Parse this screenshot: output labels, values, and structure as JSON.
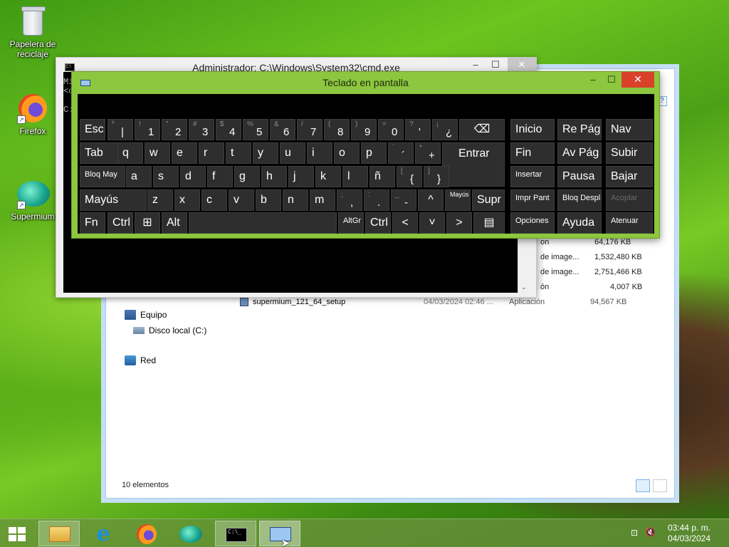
{
  "desktop": {
    "icons": [
      {
        "label": "Papelera de reciclaje"
      },
      {
        "label": "Firefox"
      },
      {
        "label": "Supermium"
      }
    ]
  },
  "explorer": {
    "nav": [
      "Equipo",
      "Disco local (C:)",
      "Red"
    ],
    "files": [
      {
        "name": "",
        "date": "",
        "type": "on",
        "size": "64,176 KB"
      },
      {
        "name": "",
        "date": "",
        "type": "de image...",
        "size": "1,532,480 KB"
      },
      {
        "name": "",
        "date": "",
        "type": "de image...",
        "size": "2,751,466 KB"
      },
      {
        "name": "",
        "date": "",
        "type": "ón",
        "size": "4,007 KB"
      },
      {
        "name": "supermium_121_64_setup",
        "date": "04/03/2024 02:46 ...",
        "type": "Aplicación",
        "size": "94,567 KB"
      }
    ],
    "status": "10 elementos"
  },
  "cmd": {
    "title": "Administrador: C:\\Windows\\System32\\cmd.exe",
    "lines": [
      "Mi",
      "<c",
      "",
      "C:"
    ]
  },
  "osk": {
    "title": "Teclado en pantalla",
    "rows": {
      "r1": [
        {
          "l": "Esc"
        },
        {
          "s": "º",
          "m": "|"
        },
        {
          "s": "!",
          "m": "1"
        },
        {
          "s": "\"",
          "m": "2"
        },
        {
          "s": "#",
          "m": "3"
        },
        {
          "s": "$",
          "m": "4"
        },
        {
          "s": "%",
          "m": "5"
        },
        {
          "s": "&",
          "m": "6"
        },
        {
          "s": "/",
          "m": "7"
        },
        {
          "s": "(",
          "m": "8"
        },
        {
          "s": ")",
          "m": "9"
        },
        {
          "s": "=",
          "m": "0"
        },
        {
          "s": "?",
          "m": "'"
        },
        {
          "s": "¡",
          "m": "¿"
        },
        {
          "l": "⌫"
        },
        {
          "l": "Inicio"
        },
        {
          "l": "Re Pág"
        },
        {
          "l": "Nav"
        }
      ],
      "r2": [
        {
          "l": "Tab"
        },
        {
          "l": "q"
        },
        {
          "l": "w"
        },
        {
          "l": "e"
        },
        {
          "l": "r"
        },
        {
          "l": "t"
        },
        {
          "l": "y"
        },
        {
          "l": "u"
        },
        {
          "l": "i"
        },
        {
          "l": "o"
        },
        {
          "l": "p"
        },
        {
          "s": "`",
          "m": "´"
        },
        {
          "s": "*",
          "m": "+"
        },
        {
          "l": "Entrar"
        },
        {
          "l": "Fin"
        },
        {
          "l": "Av Pág"
        },
        {
          "l": "Subir"
        }
      ],
      "r3": [
        {
          "l": "Bloq May"
        },
        {
          "l": "a"
        },
        {
          "l": "s"
        },
        {
          "l": "d"
        },
        {
          "l": "f"
        },
        {
          "l": "g"
        },
        {
          "l": "h"
        },
        {
          "l": "j"
        },
        {
          "l": "k"
        },
        {
          "l": "l"
        },
        {
          "l": "ñ"
        },
        {
          "s": "[",
          "m": "{"
        },
        {
          "s": "]",
          "m": "}"
        },
        {
          "l": "Insertar"
        },
        {
          "l": "Pausa"
        },
        {
          "l": "Bajar"
        }
      ],
      "r4": [
        {
          "l": "Mayús"
        },
        {
          "l": "z"
        },
        {
          "l": "x"
        },
        {
          "l": "c"
        },
        {
          "l": "v"
        },
        {
          "l": "b"
        },
        {
          "l": "n"
        },
        {
          "l": "m"
        },
        {
          "s": ";",
          "m": ","
        },
        {
          "s": ":",
          "m": "."
        },
        {
          "s": "_",
          "m": "-"
        },
        {
          "l": "^"
        },
        {
          "l": "Mayús"
        },
        {
          "l": "Supr"
        },
        {
          "l": "Impr Pant"
        },
        {
          "l": "Bloq Despl"
        },
        {
          "l": "Acoplar"
        }
      ],
      "r5": [
        {
          "l": "Fn"
        },
        {
          "l": "Ctrl"
        },
        {
          "l": "⊞"
        },
        {
          "l": "Alt"
        },
        {
          "l": ""
        },
        {
          "l": "AltGr"
        },
        {
          "l": "Ctrl"
        },
        {
          "l": "<"
        },
        {
          "l": "˅"
        },
        {
          "l": ">"
        },
        {
          "l": "▤"
        },
        {
          "l": "Opciones"
        },
        {
          "l": "Ayuda"
        },
        {
          "l": "Atenuar"
        }
      ]
    }
  },
  "taskbar": {
    "time": "03:44 p. m.",
    "date": "04/03/2024"
  }
}
